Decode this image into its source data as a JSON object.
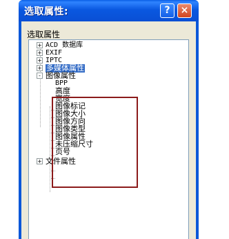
{
  "dialog": {
    "title": "选取属性:",
    "help_glyph": "?",
    "close_glyph": "×",
    "group_label": "选取属性"
  },
  "tree": {
    "items": [
      {
        "label": "ACD 数据库",
        "expander": "+"
      },
      {
        "label": "EXIF",
        "expander": "+"
      },
      {
        "label": "IPTC",
        "expander": "+"
      },
      {
        "label": "多媒体属性",
        "expander": "+",
        "selected": true
      },
      {
        "label": "图像属性",
        "expander": "-"
      },
      {
        "label": "文件属性",
        "expander": "+"
      }
    ],
    "image_children": [
      "BPP",
      "高度",
      "宽度",
      "图像标记",
      "图像大小",
      "图像方向",
      "图像类型",
      "图像属性",
      "未压缩尺寸",
      "页号"
    ]
  },
  "colors": {
    "selection": "#316ac5",
    "highlight_box": "#8b1a1a",
    "title_bar": "#0a58e0"
  }
}
